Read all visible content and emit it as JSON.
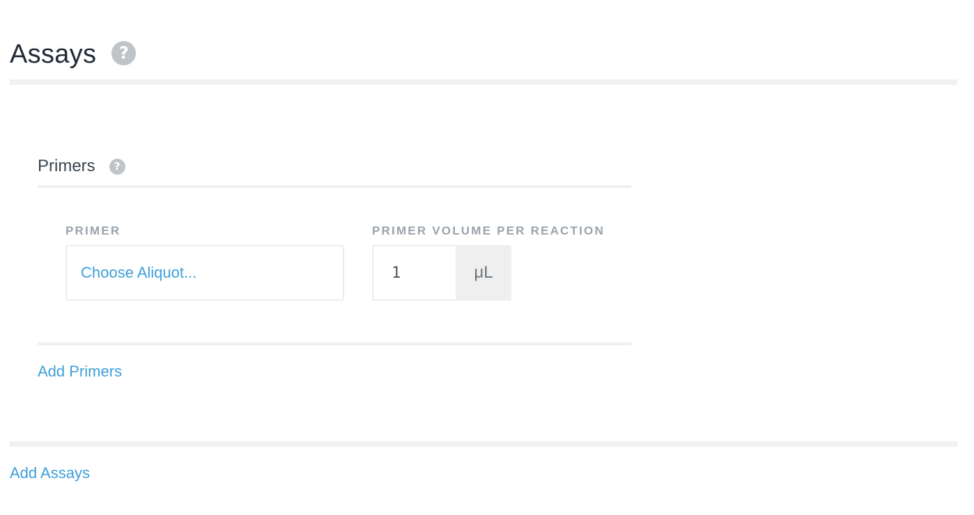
{
  "assays": {
    "title": "Assays",
    "help_glyph": "?",
    "add_label": "Add Assays"
  },
  "primers": {
    "title": "Primers",
    "help_glyph": "?",
    "add_label": "Add Primers",
    "fields": {
      "primer_label": "PRIMER",
      "primer_placeholder": "Choose Aliquot...",
      "volume_label": "PRIMER VOLUME PER REACTION",
      "volume_value": "1",
      "volume_unit": "μL"
    }
  },
  "icons": {
    "help": "question-circle-icon"
  },
  "colors": {
    "link": "#3d9fd9",
    "label": "#9aa3ab",
    "divider": "#f1f1f1",
    "help_icon": "#bfc4c9"
  }
}
